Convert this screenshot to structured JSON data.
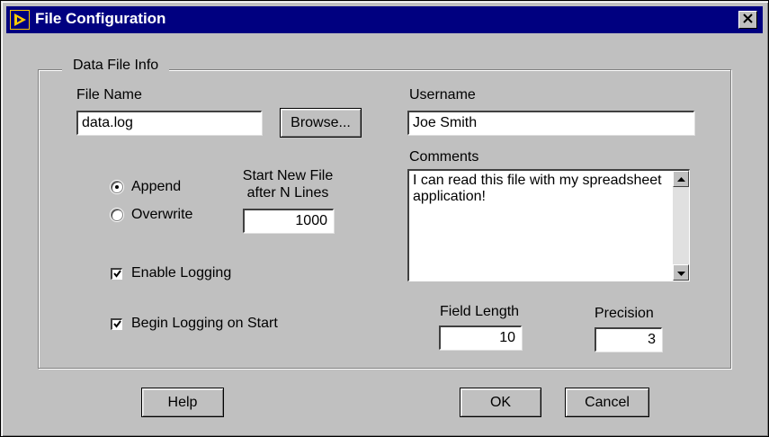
{
  "window": {
    "title": "File Configuration",
    "close_glyph": "✕"
  },
  "group": {
    "label": "Data File Info"
  },
  "file_name": {
    "label": "File Name",
    "value": "data.log"
  },
  "browse": {
    "label": "Browse..."
  },
  "username": {
    "label": "Username",
    "value": "Joe Smith"
  },
  "comments": {
    "label": "Comments",
    "value": "I can read this file with my spreadsheet application!"
  },
  "mode": {
    "append_label": "Append",
    "overwrite_label": "Overwrite",
    "selected": "Append"
  },
  "start_new_file": {
    "label_line1": "Start New File",
    "label_line2": "after N Lines",
    "value": "1000"
  },
  "enable_logging": {
    "label": "Enable Logging",
    "checked": true
  },
  "begin_logging": {
    "label": "Begin Logging on Start",
    "checked": true
  },
  "field_length": {
    "label": "Field Length",
    "value": "10"
  },
  "precision": {
    "label": "Precision",
    "value": "3"
  },
  "buttons": {
    "help": "Help",
    "ok": "OK",
    "cancel": "Cancel"
  },
  "icons": {
    "app": "labview-icon",
    "close": "close-icon",
    "check": "checkmark-icon",
    "scroll_up": "scroll-up-arrow-icon",
    "scroll_down": "scroll-down-arrow-icon"
  },
  "colors": {
    "titlebar": "#000080",
    "face": "#c0c0c0",
    "field": "#ffffff"
  }
}
